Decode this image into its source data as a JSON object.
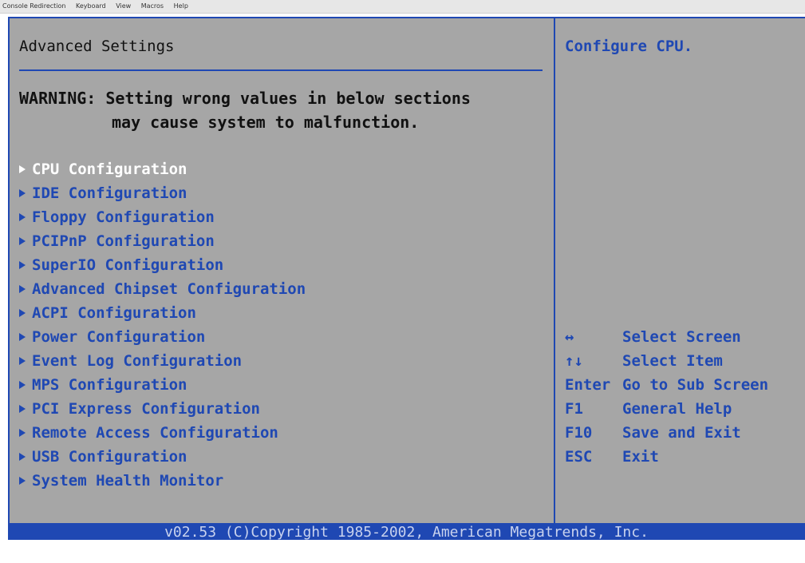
{
  "window": {
    "menu": [
      "Console Redirection",
      "Keyboard",
      "View",
      "Macros",
      "Help"
    ]
  },
  "bios": {
    "title": "Advanced Settings",
    "warning_line1": "WARNING: Setting wrong values in below sections",
    "warning_line2": "may cause system to malfunction.",
    "menu_items": [
      {
        "label": "CPU Configuration",
        "selected": true
      },
      {
        "label": "IDE Configuration"
      },
      {
        "label": "Floppy Configuration"
      },
      {
        "label": "PCIPnP Configuration"
      },
      {
        "label": "SuperIO Configuration"
      },
      {
        "label": "Advanced Chipset Configuration"
      },
      {
        "label": "ACPI Configuration"
      },
      {
        "label": "Power Configuration"
      },
      {
        "label": "Event Log Configuration"
      },
      {
        "label": "MPS Configuration"
      },
      {
        "label": "PCI Express Configuration"
      },
      {
        "label": "Remote Access Configuration"
      },
      {
        "label": "USB Configuration"
      },
      {
        "label": "System Health Monitor"
      }
    ],
    "help_text": "Configure CPU.",
    "keys": [
      {
        "key": "↔",
        "action": "Select Screen"
      },
      {
        "key": "↑↓",
        "action": "Select Item"
      },
      {
        "key": "Enter",
        "action": "Go to Sub Screen"
      },
      {
        "key": "F1",
        "action": "General Help"
      },
      {
        "key": "F10",
        "action": "Save and Exit"
      },
      {
        "key": "ESC",
        "action": "Exit"
      }
    ],
    "footer": "v02.53 (C)Copyright 1985-2002, American Megatrends, Inc."
  },
  "colors": {
    "background": "#a6a6a6",
    "accent": "#1f48b3",
    "selected_text": "#ffffff",
    "footer_text": "#c8d2ee"
  }
}
